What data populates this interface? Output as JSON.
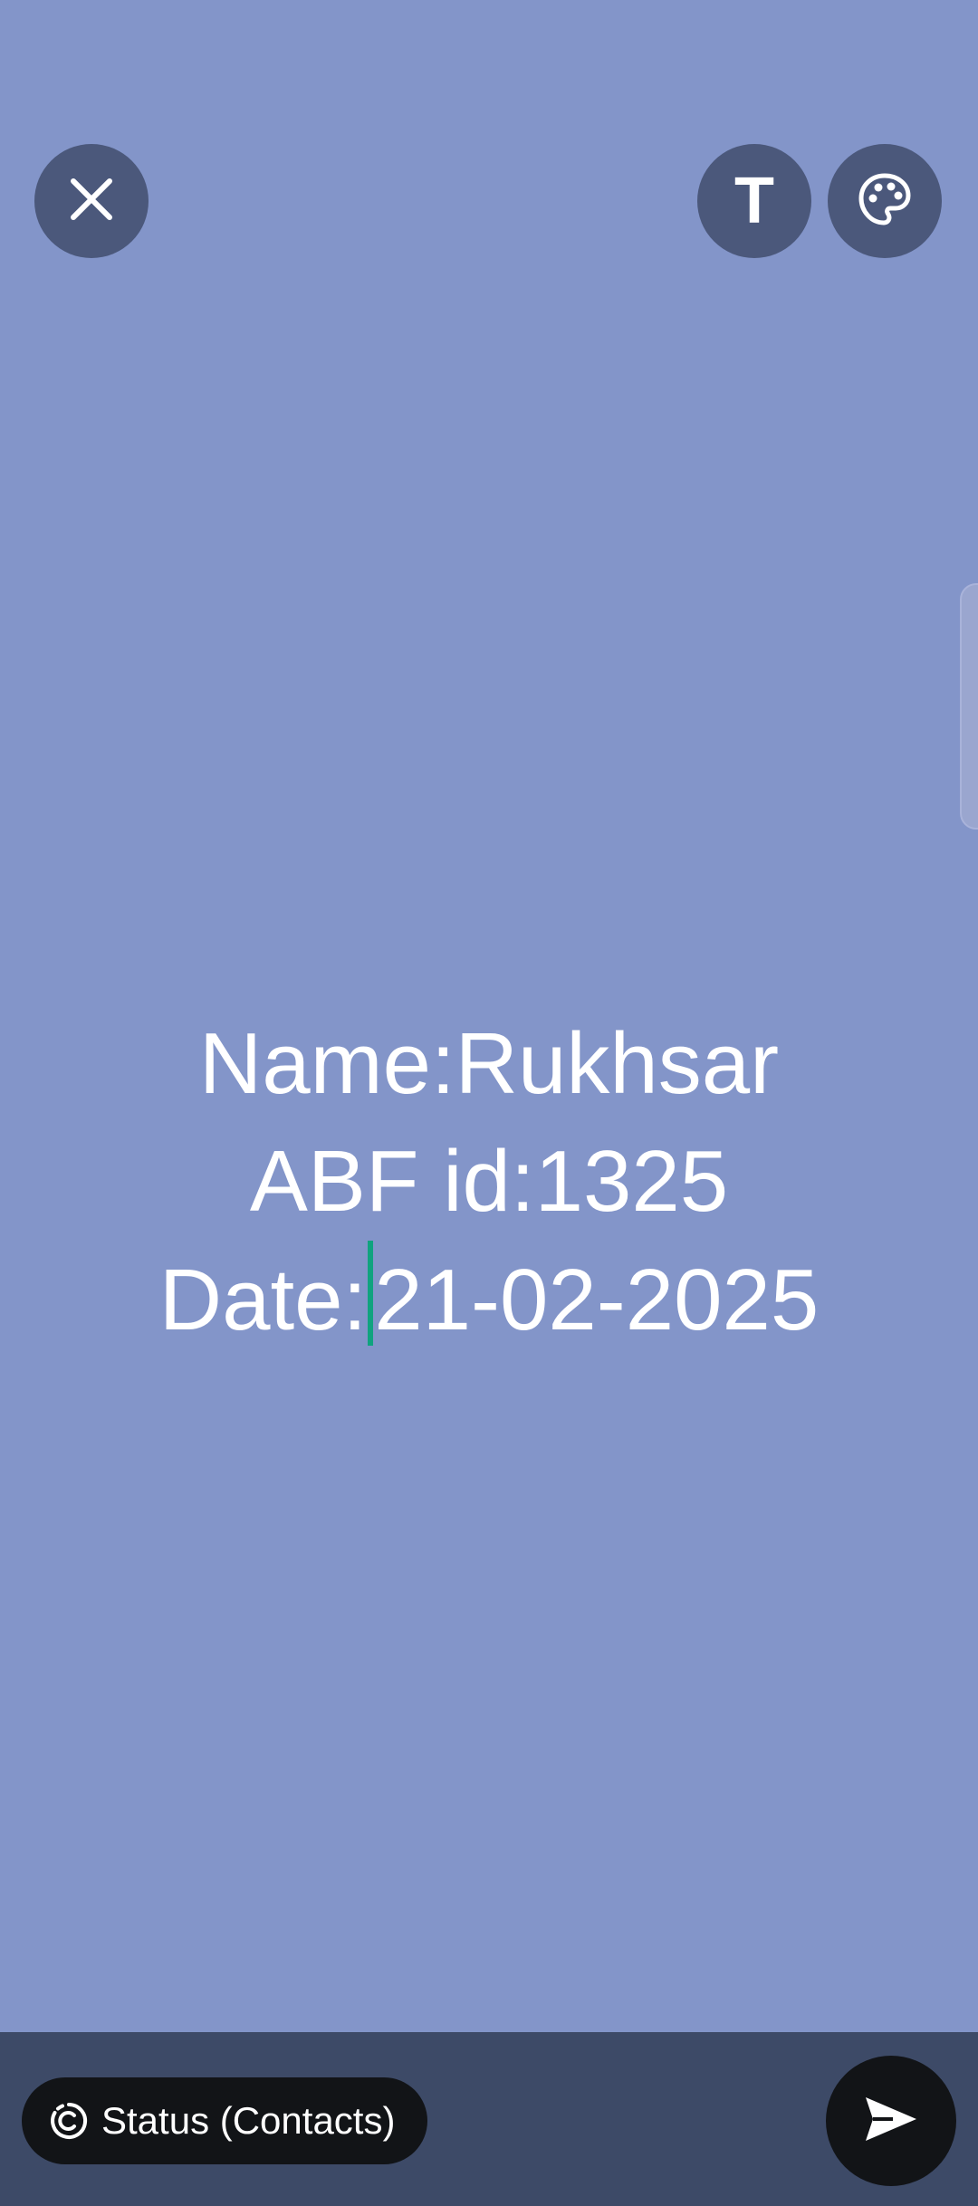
{
  "toolbar": {
    "close_icon": "close-icon",
    "text_tool_label": "T",
    "palette_icon": "palette-icon"
  },
  "status_text": {
    "lines": [
      "Name:Rukhsar",
      "ABF id:1325",
      "Date:"
    ],
    "line3_after_caret": "21-02-2025"
  },
  "footer": {
    "audience_label": "Status (Contacts)",
    "audience_icon": "status-icon",
    "send_icon": "send-icon"
  },
  "colors": {
    "background": "#8395c9",
    "button_bg": "#4b587b",
    "bottom_bar": "#3d4a67",
    "caret": "#10a37f",
    "chip_bg": "#121417"
  }
}
